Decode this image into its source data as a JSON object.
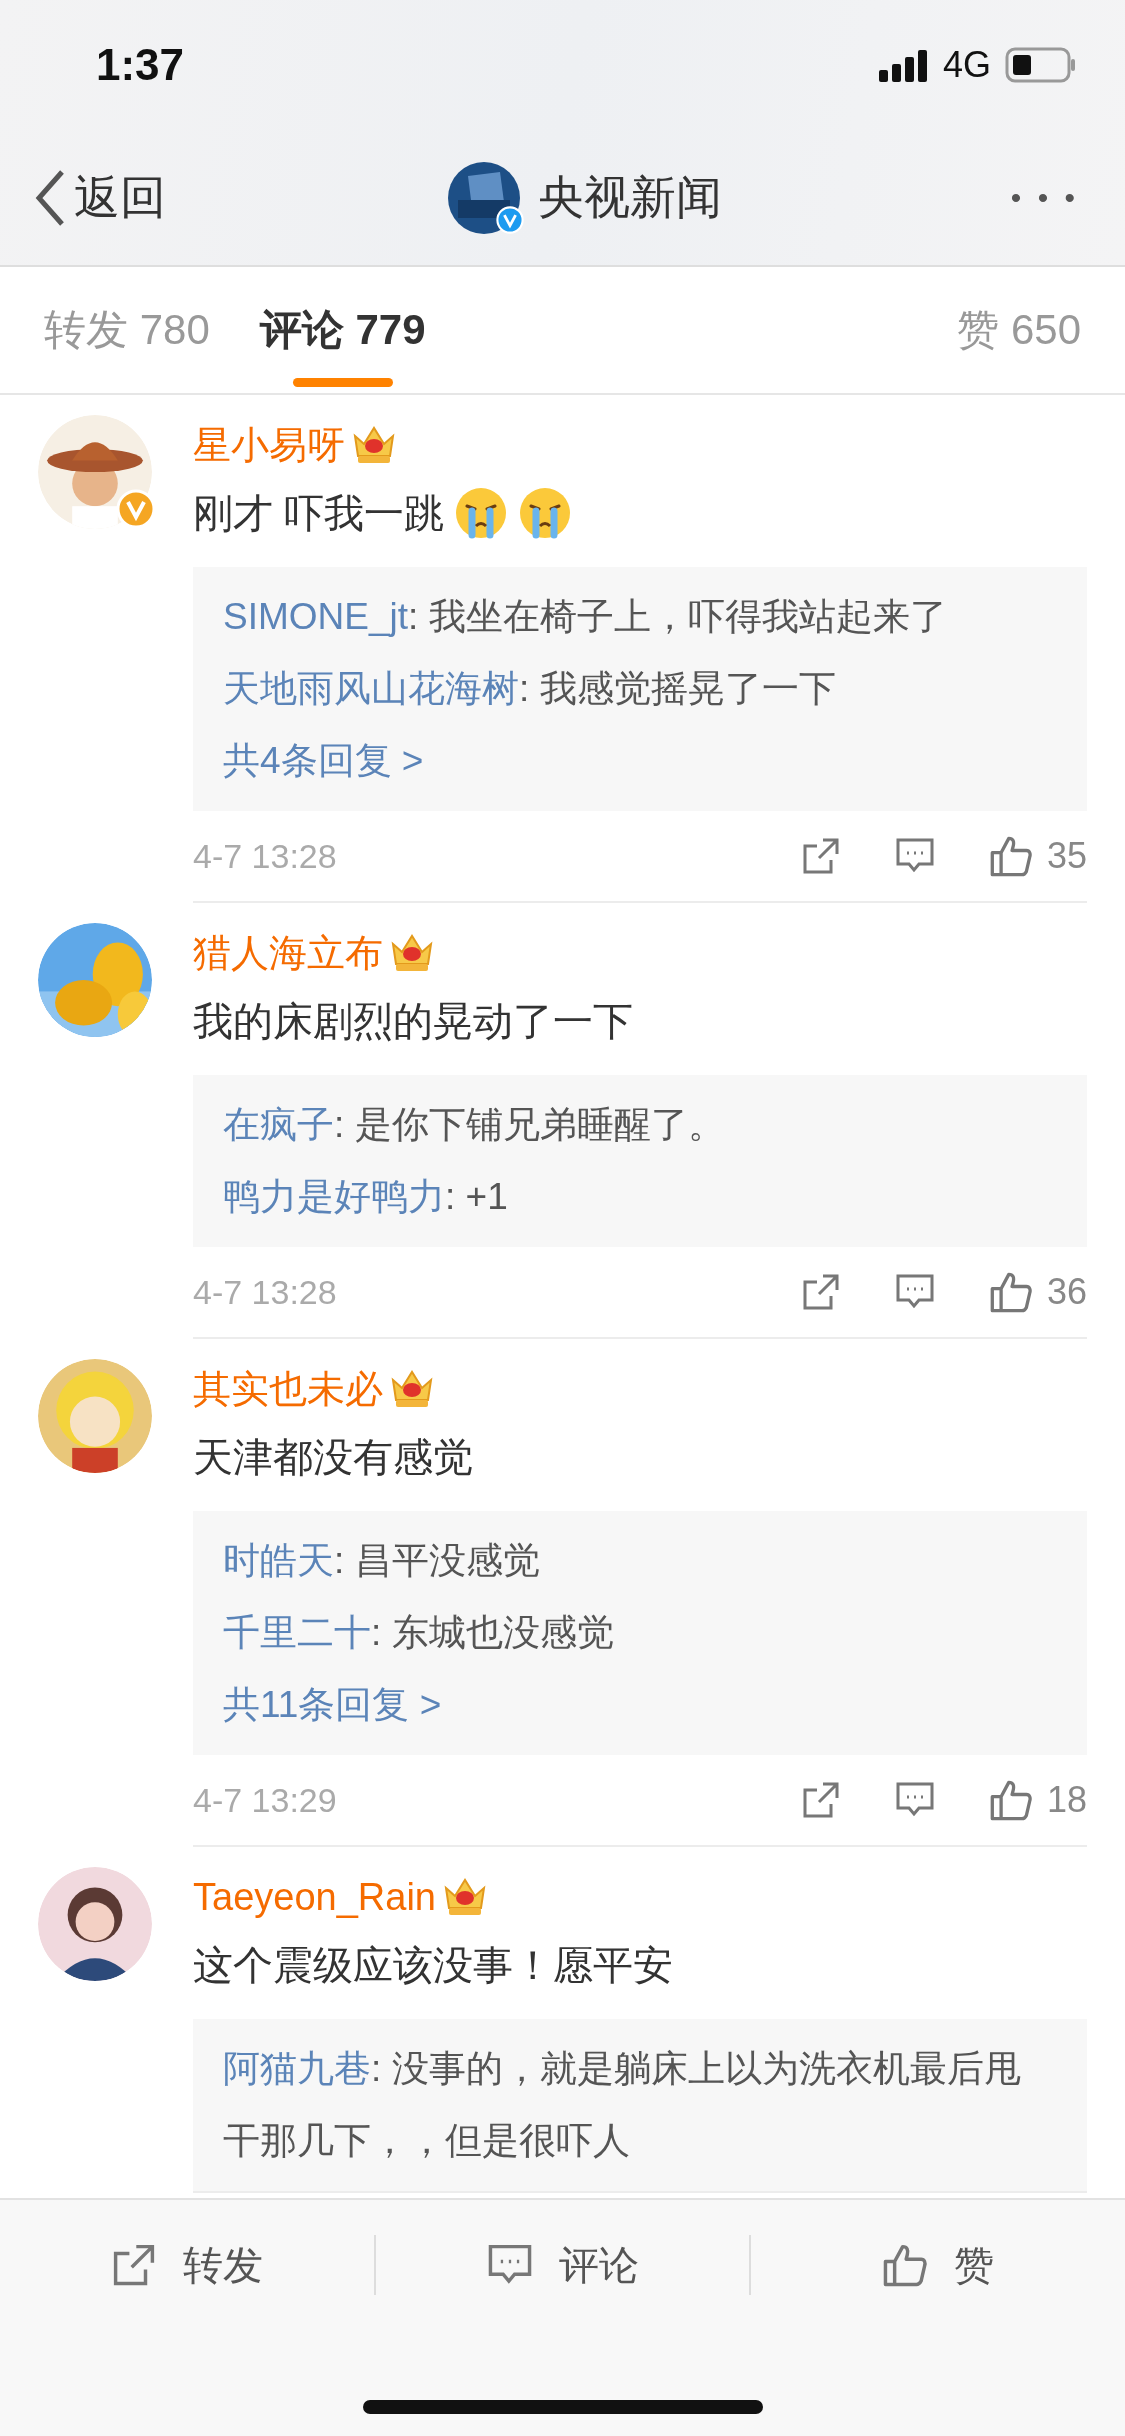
{
  "status_bar": {
    "time": "1:37",
    "network": "4G"
  },
  "nav": {
    "back_label": "返回",
    "title": "央视新闻",
    "verified": true,
    "more": "• • •"
  },
  "tabs": [
    {
      "label": "转发 780",
      "selected": false
    },
    {
      "label": "评论 779",
      "selected": true
    },
    {
      "label": "赞 650",
      "selected": false
    }
  ],
  "comments": [
    {
      "name": "星小易呀",
      "member_badge": true,
      "verified": true,
      "text": "刚才 吓我一跳",
      "emoji": [
        {
          "kind": "crying"
        },
        {
          "kind": "crying"
        }
      ],
      "replies": [
        {
          "user": "SIMONE_jt",
          "text": ": 我坐在椅子上，吓得我站起来了"
        },
        {
          "user": "天地雨风山花海树",
          "text": ": 我感觉摇晃了一下"
        }
      ],
      "more_replies": "共4条回复 >",
      "time": "4-7 13:28",
      "likes": "35"
    },
    {
      "name": "猎人海立布",
      "member_badge": true,
      "verified": false,
      "text": "我的床剧烈的晃动了一下",
      "replies": [
        {
          "user": "在疯子",
          "text": ": 是你下铺兄弟睡醒了。"
        },
        {
          "user": "鸭力是好鸭力",
          "text": ": +1"
        }
      ],
      "time": "4-7 13:28",
      "likes": "36"
    },
    {
      "name": "其实也未必",
      "member_badge": true,
      "verified": false,
      "text": "天津都没有感觉",
      "replies": [
        {
          "user": "时皓天",
          "text": ": 昌平没感觉"
        },
        {
          "user": "千里二十",
          "text": ": 东城也没感觉"
        }
      ],
      "more_replies": "共11条回复 >",
      "time": "4-7 13:29",
      "likes": "18"
    },
    {
      "name": "Taeyeon_Rain",
      "member_badge": true,
      "verified": false,
      "text": "这个震级应该没事！愿平安",
      "replies": [
        {
          "user": "阿猫九巷",
          "text": ": 没事的，就是躺床上以为洗衣机最后甩干那几下，，但是很吓人"
        }
      ]
    }
  ],
  "bottom_bar": [
    {
      "kind": "share",
      "label": "转发"
    },
    {
      "kind": "comment",
      "label": "评论"
    },
    {
      "kind": "like",
      "label": "赞"
    }
  ]
}
